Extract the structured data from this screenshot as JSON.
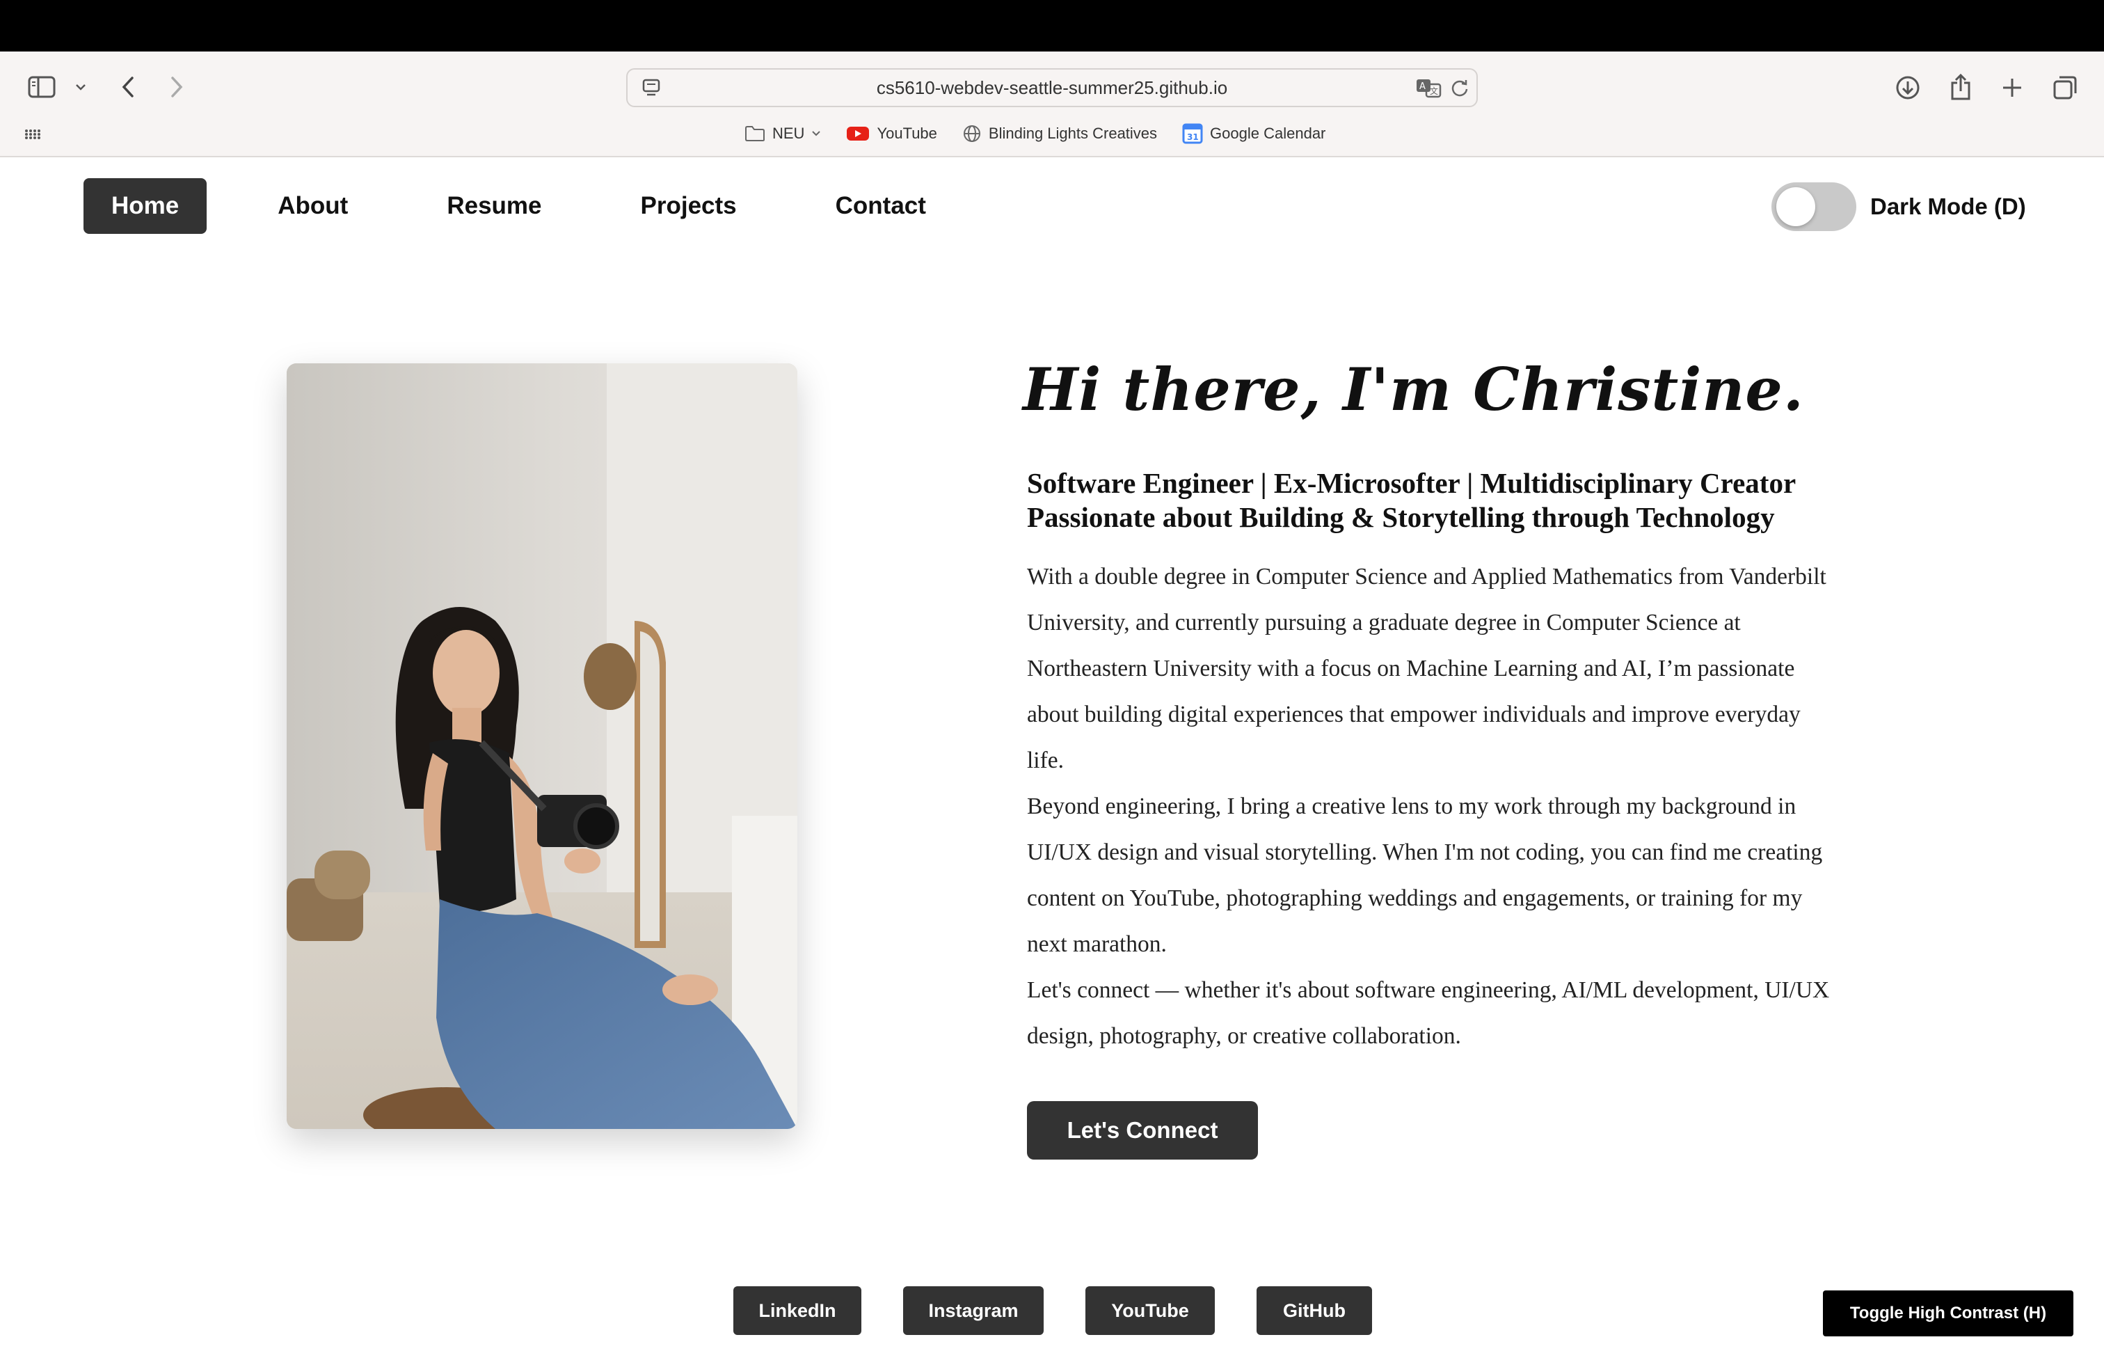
{
  "browser": {
    "url": "cs5610-webdev-seattle-summer25.github.io",
    "bookmarks": [
      {
        "label": "NEU",
        "icon": "folder-icon"
      },
      {
        "label": "YouTube",
        "icon": "youtube-icon"
      },
      {
        "label": "Blinding Lights Creatives",
        "icon": "globe-icon"
      },
      {
        "label": "Google Calendar",
        "icon": "calendar-icon"
      }
    ],
    "calendar_badge": "31"
  },
  "nav": {
    "items": [
      {
        "label": "Home",
        "active": true
      },
      {
        "label": "About"
      },
      {
        "label": "Resume"
      },
      {
        "label": "Projects"
      },
      {
        "label": "Contact"
      }
    ],
    "dark_mode_label": "Dark Mode (D)",
    "dark_mode_on": false
  },
  "hero": {
    "greeting": "Hi there, I'm Christine.",
    "tagline_line1": "Software Engineer | Ex-Microsofter | Multidisciplinary Creator",
    "tagline_line2": "Passionate about Building & Storytelling through Technology",
    "bio": [
      "With a double degree in Computer Science and Applied Mathematics from Vanderbilt University, and currently pursuing a graduate degree in Computer Science at Northeastern University with a focus on Machine Learning and AI, I’m passionate about building digital experiences that empower individuals and improve everyday life.",
      "Beyond engineering, I bring a creative lens to my work through my background in UI/UX design and visual storytelling. When I'm not coding, you can find me creating content on YouTube, photographing weddings and engagements, or training for my next marathon.",
      "Let's connect — whether it's about software engineering, AI/ML development, UI/UX design, photography, or creative collaboration."
    ],
    "cta_label": "Let's Connect"
  },
  "footer": {
    "socials": [
      "LinkedIn",
      "Instagram",
      "YouTube",
      "GitHub"
    ],
    "high_contrast_label": "Toggle High Contrast (H)"
  },
  "colors": {
    "button_bg": "#333333",
    "chrome_bg": "#f7f4f3",
    "youtube_red": "#e62117"
  }
}
